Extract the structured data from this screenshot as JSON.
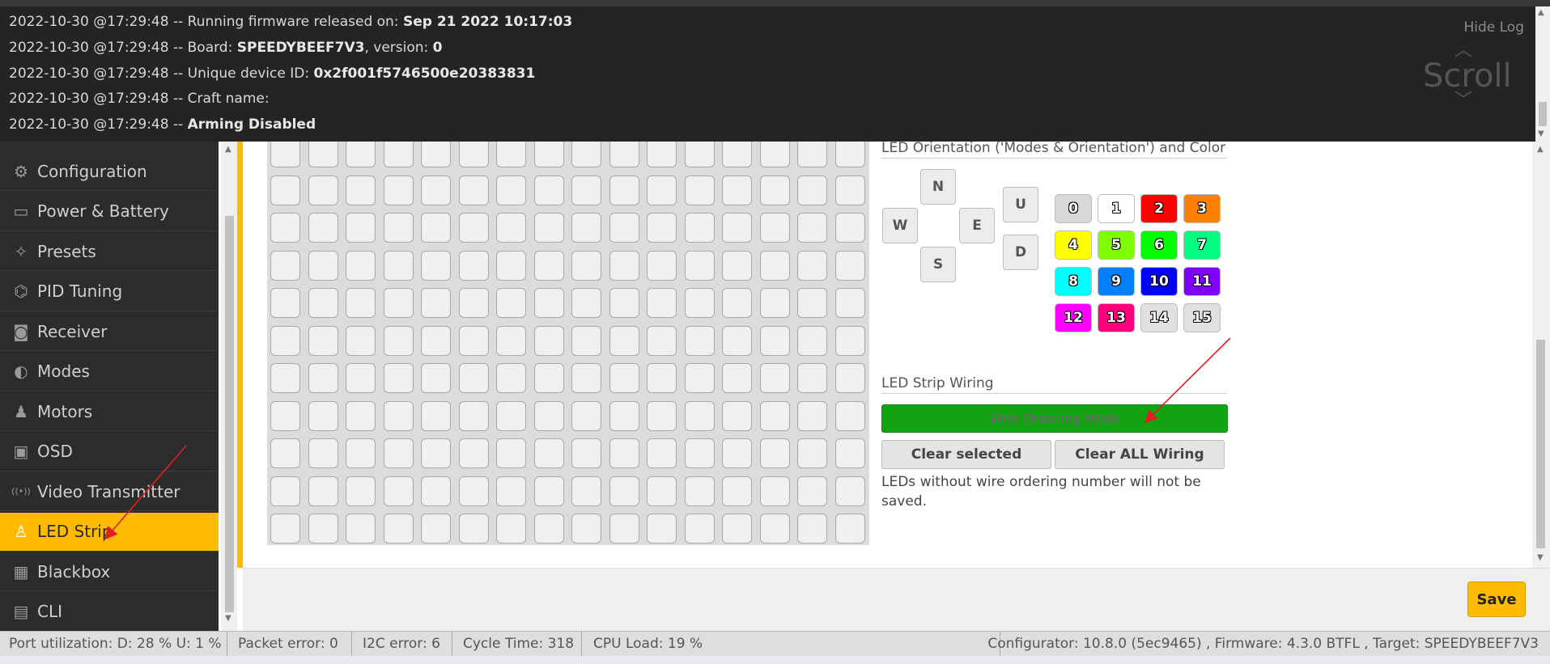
{
  "log": {
    "lines": [
      {
        "prefix": "2022-10-30 @17:29:48 -- Running firmware released on: ",
        "bold": "Sep 21 2022 10:17:03",
        "suffix": ""
      },
      {
        "prefix": "2022-10-30 @17:29:48 -- Board: ",
        "bold": "SPEEDYBEEF7V3",
        "suffix": ", version: ",
        "bold2": "0"
      },
      {
        "prefix": "2022-10-30 @17:29:48 -- Unique device ID: ",
        "bold": "0x2f001f5746500e20383831",
        "suffix": ""
      },
      {
        "prefix": "2022-10-30 @17:29:48 -- Craft name:",
        "bold": "",
        "suffix": ""
      },
      {
        "prefix": "2022-10-30 @17:29:48 -- ",
        "bold": "Arming Disabled",
        "suffix": ""
      }
    ],
    "hide_label": "Hide Log",
    "scroll_label": "Scroll"
  },
  "sidebar": {
    "items": [
      {
        "label": "Configuration",
        "icon": "gear-icon",
        "glyph": "⚙"
      },
      {
        "label": "Power & Battery",
        "icon": "battery-icon",
        "glyph": "▭"
      },
      {
        "label": "Presets",
        "icon": "wand-icon",
        "glyph": "✧"
      },
      {
        "label": "PID Tuning",
        "icon": "sitemap-icon",
        "glyph": "⌬"
      },
      {
        "label": "Receiver",
        "icon": "robot-icon",
        "glyph": "◙"
      },
      {
        "label": "Modes",
        "icon": "toggle-icon",
        "glyph": "◐"
      },
      {
        "label": "Motors",
        "icon": "motor-icon",
        "glyph": "♟"
      },
      {
        "label": "OSD",
        "icon": "osd-icon",
        "glyph": "▣"
      },
      {
        "label": "Video Transmitter",
        "icon": "antenna-icon",
        "glyph": "((•))"
      },
      {
        "label": "LED Strip",
        "icon": "bulb-icon",
        "glyph": "♙"
      },
      {
        "label": "Blackbox",
        "icon": "chip-icon",
        "glyph": "▦"
      },
      {
        "label": "CLI",
        "icon": "terminal-icon",
        "glyph": "▤"
      }
    ],
    "active": "LED Strip"
  },
  "orientation": {
    "title": "LED Orientation ('Modes & Orientation') and Color",
    "directions": {
      "n": "N",
      "w": "W",
      "e": "E",
      "s": "S",
      "u": "U",
      "d": "D"
    },
    "colors": [
      {
        "label": "0",
        "color": "#d8d8d8"
      },
      {
        "label": "1",
        "color": "#ffffff"
      },
      {
        "label": "2",
        "color": "#ff0000"
      },
      {
        "label": "3",
        "color": "#ff7f00"
      },
      {
        "label": "4",
        "color": "#ffff00"
      },
      {
        "label": "5",
        "color": "#80ff00"
      },
      {
        "label": "6",
        "color": "#00ff00"
      },
      {
        "label": "7",
        "color": "#00ff80"
      },
      {
        "label": "8",
        "color": "#00ffff"
      },
      {
        "label": "9",
        "color": "#0080ff"
      },
      {
        "label": "10",
        "color": "#0000ff"
      },
      {
        "label": "11",
        "color": "#8000ff"
      },
      {
        "label": "12",
        "color": "#ff00ff"
      },
      {
        "label": "13",
        "color": "#ff0080"
      },
      {
        "label": "14",
        "color": "#e0e0e0"
      },
      {
        "label": "15",
        "color": "#e0e0e0"
      }
    ]
  },
  "wiring": {
    "title": "LED Strip Wiring",
    "wire_mode_label": "Wire Ordering Mode",
    "clear_selected_label": "Clear selected",
    "clear_all_label": "Clear ALL Wiring",
    "note": "LEDs without wire ordering number will not be saved."
  },
  "toolbar": {
    "save_label": "Save"
  },
  "status": {
    "port_util": "Port utilization: D: 28 % U: 1 %",
    "packet_error": "Packet error: 0",
    "i2c_error": "I2C error: 6",
    "cycle_time": "Cycle Time: 318",
    "cpu_load": "CPU Load: 19 %",
    "version_info": "Configurator: 10.8.0 (5ec9465) , Firmware: 4.3.0 BTFL , Target: SPEEDYBEEF7V3"
  },
  "colors": {
    "accent": "#ffbb00",
    "wire_mode_green": "#12a312",
    "annotation_arrow": "#e02020"
  }
}
